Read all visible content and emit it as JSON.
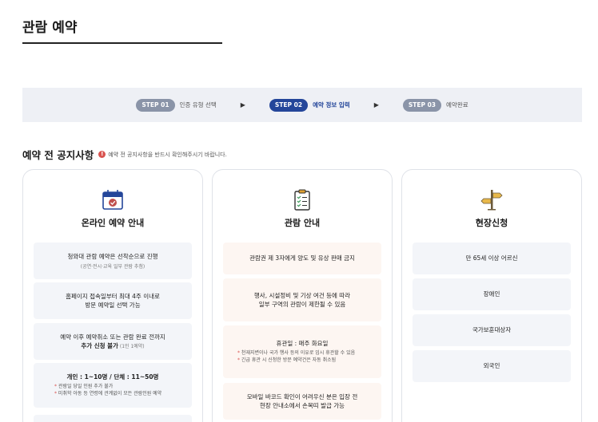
{
  "page": {
    "title": "관람 예약"
  },
  "steps": [
    {
      "badge": "STEP 01",
      "label": "인증 유형 선택",
      "active": false
    },
    {
      "badge": "STEP 02",
      "label": "예약 정보 입력",
      "active": true
    },
    {
      "badge": "STEP 03",
      "label": "예약완료",
      "active": false
    }
  ],
  "notice": {
    "title": "예약 전 공지사항",
    "warning_icon": "!",
    "subtitle": "예약 전 공지사항을 반드시 확인해주시기 바랍니다."
  },
  "cards": [
    {
      "title": "온라인 예약 안내",
      "icon": "calendar-check-icon",
      "items": [
        {
          "main": "청와대 관람 예약은 선착순으로 진행",
          "sub": "(공연·전시·교육 일부 관람 추첨)"
        },
        {
          "main": "홈페이지 접속일부터 최대 4주 이내로",
          "main2": "방문 예약일 선택 가능"
        },
        {
          "main": "예약 이후 예약취소 또는 관람 완료 전까지",
          "main2": "추가 신청 불가",
          "main2_suffix": " (1인 1예약)"
        },
        {
          "main": "개인 : 1~10명 / 단체 : 11~50명",
          "bullets": [
            "관람일 당일 인원 추가 불가",
            "미취학 아동 등 연령에 관계없이 모든 관람인원 예약"
          ]
        }
      ]
    },
    {
      "title": "관람 안내",
      "icon": "clipboard-checklist-icon",
      "items": [
        {
          "main": "관람권 제 3자에게 양도 및 유상 판매 금지"
        },
        {
          "main": "행사, 시설정비 및 기상 여건 등에 따라",
          "main2": "일부 구역의 관람이 제한될 수 있음"
        },
        {
          "main": "휴관일 : 매주 화요일",
          "bullets": [
            "천재지변이나 국가 행사 등의 이유로 임시 휴관할 수 있음",
            "긴급 휴관 시 신청한 방문 예약건은 자동 취소됨"
          ]
        },
        {
          "main": "모바일 바코드 확인이 어려우신 분은 입장 전",
          "main2": "현장 안내소에서 손목띠 발급 가능"
        }
      ]
    },
    {
      "title": "현장신청",
      "icon": "signpost-icon",
      "items": [
        {
          "main": "만 65세 이상 어르신"
        },
        {
          "main": "장애인"
        },
        {
          "main": "국가보훈대상자"
        },
        {
          "main": "외국인"
        }
      ]
    }
  ],
  "colors": {
    "accent": "#24469a",
    "step_inactive": "#8a94a8",
    "warning": "#d9534f"
  }
}
